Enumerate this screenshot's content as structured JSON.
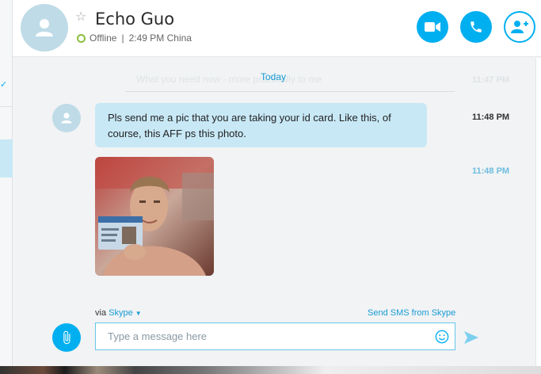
{
  "contact": {
    "name": "Echo Guo",
    "status": "Offline",
    "local_time": "2:49 PM China",
    "separator": "|"
  },
  "header_actions": {
    "video_icon": "video-camera-icon",
    "call_icon": "phone-icon",
    "add_icon": "add-person-icon",
    "favorite_icon": "star-outline-icon"
  },
  "conversation": {
    "faded_message": "What you need now - more practically to me",
    "faded_time": "11:47 PM",
    "date_divider": "Today",
    "messages": [
      {
        "text": "Pls send me a pic that you are taking your id card. Like this, of course, this AFF ps this photo.",
        "time": "11:48 PM"
      },
      {
        "type": "image",
        "time": "11:48 PM"
      }
    ]
  },
  "compose": {
    "via_label": "via",
    "via_service": "Skype",
    "send_sms_label": "Send SMS from Skype",
    "placeholder": "Type a message here",
    "value": ""
  },
  "colors": {
    "accent": "#00aff0",
    "bubble": "#c8e8f6",
    "status_offline": "#8cbf3f"
  }
}
